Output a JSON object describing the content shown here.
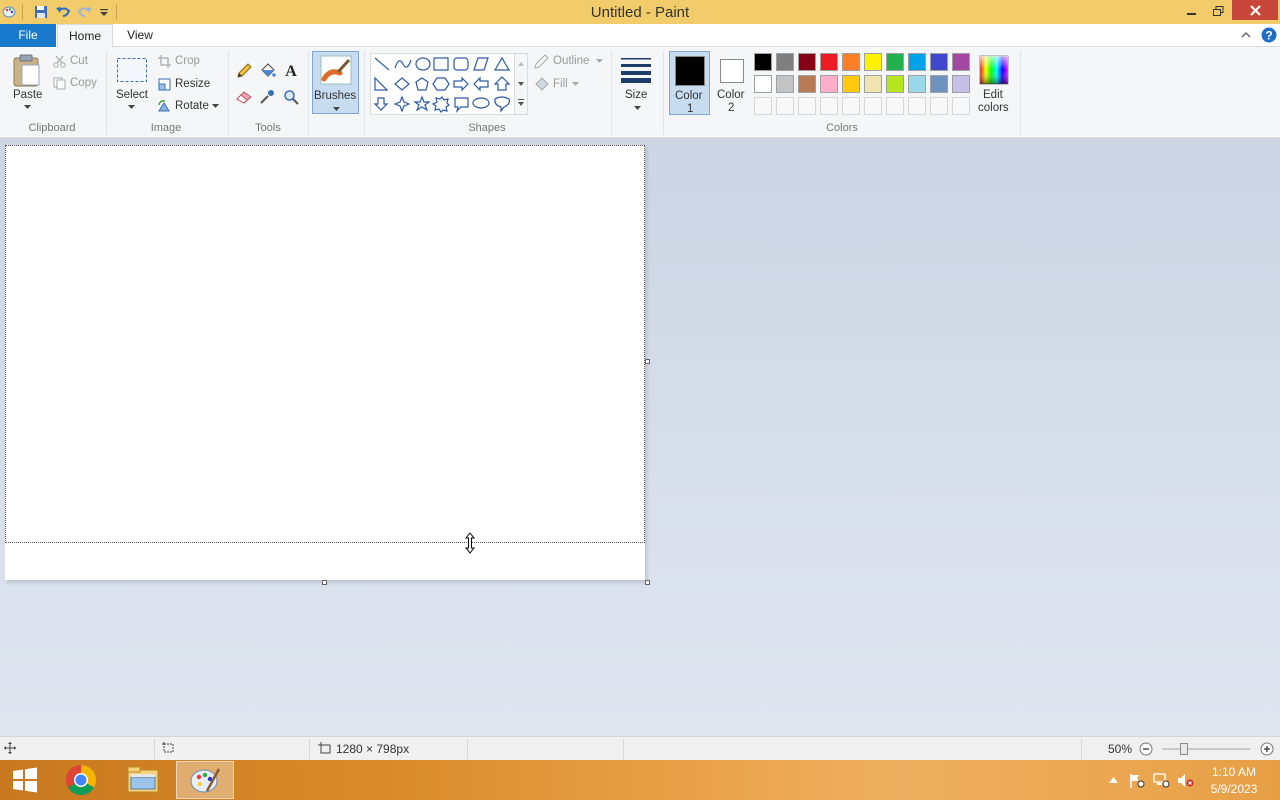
{
  "window": {
    "title": "Untitled - Paint"
  },
  "quick_access": [
    "save-icon",
    "undo-icon",
    "redo-icon",
    "customize-icon"
  ],
  "tabs": {
    "file": "File",
    "home": "Home",
    "view": "View"
  },
  "ribbon": {
    "clipboard": {
      "paste": "Paste",
      "cut": "Cut",
      "copy": "Copy",
      "label": "Clipboard"
    },
    "image": {
      "select": "Select",
      "crop": "Crop",
      "resize": "Resize",
      "rotate": "Rotate",
      "label": "Image"
    },
    "tools": {
      "label": "Tools"
    },
    "brushes": "Brushes",
    "shapes": {
      "outline": "Outline",
      "fill": "Fill",
      "label": "Shapes"
    },
    "size": "Size",
    "colors": {
      "color1": "Color",
      "color1_num": "1",
      "color2": "Color",
      "color2_num": "2",
      "edit_colors_1": "Edit",
      "edit_colors_2": "colors",
      "label": "Colors",
      "color1_value": "#000000",
      "color2_value": "#ffffff",
      "palette_row1": [
        "#000000",
        "#7f7f7f",
        "#880015",
        "#ed1c24",
        "#ff7f27",
        "#fff200",
        "#22b14c",
        "#00a2e8",
        "#3f48cc",
        "#a349a4"
      ],
      "palette_row2": [
        "#ffffff",
        "#c3c3c3",
        "#b97a57",
        "#ffaec9",
        "#ffc90e",
        "#efe4b0",
        "#b5e61d",
        "#99d9ea",
        "#7092be",
        "#c8bfe7"
      ]
    }
  },
  "status": {
    "dimensions": "1280 × 798px",
    "zoom": "50%"
  },
  "taskbar": {
    "clock_time": "1:10 AM",
    "clock_date": "5/9/2023"
  },
  "accent": "#1979ca"
}
